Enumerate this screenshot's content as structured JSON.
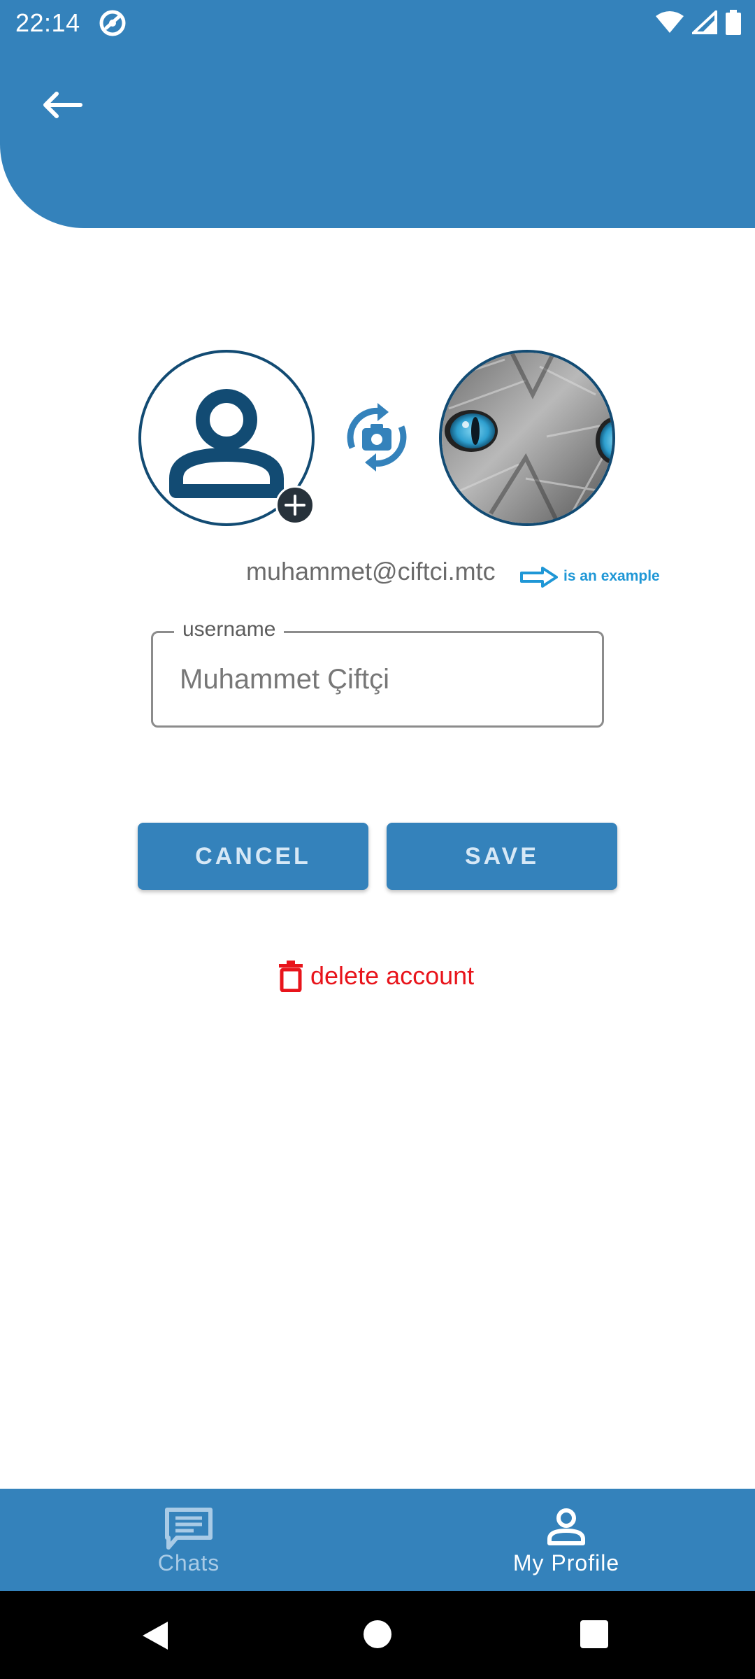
{
  "status_bar": {
    "time": "22:14"
  },
  "profile": {
    "email": "muhammet@ciftci.mtc",
    "example_note": "is an example",
    "username_label": "username",
    "username_value": "Muhammet Çiftçi"
  },
  "actions": {
    "cancel_label": "CANCEL",
    "save_label": "SAVE",
    "delete_label": "delete account"
  },
  "bottom_nav": {
    "items": [
      {
        "label": "Chats",
        "icon": "chat-icon",
        "active": false
      },
      {
        "label": "My Profile",
        "icon": "person-icon",
        "active": true
      }
    ]
  },
  "colors": {
    "primary": "#3482bb",
    "avatar_border": "#124b73",
    "danger": "#e8141b",
    "example_note": "#1f97d6"
  }
}
